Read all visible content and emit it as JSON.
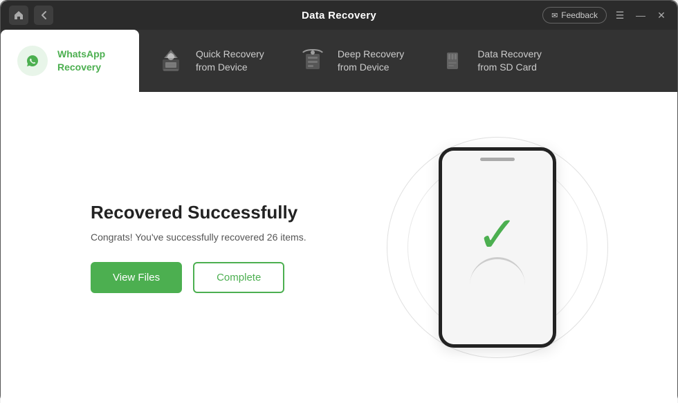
{
  "titleBar": {
    "title": "Data Recovery",
    "feedbackLabel": "Feedback",
    "homeIcon": "home-icon",
    "backIcon": "back-icon",
    "menuIcon": "menu-icon",
    "minimizeIcon": "minimize-icon",
    "closeIcon": "close-icon"
  },
  "navTabs": [
    {
      "id": "whatsapp",
      "label": "WhatsApp\nRecovery",
      "active": true
    },
    {
      "id": "quick-recovery",
      "label": "Quick Recovery\nfrom Device",
      "active": false
    },
    {
      "id": "deep-recovery",
      "label": "Deep Recovery\nfrom Device",
      "active": false
    },
    {
      "id": "sd-card",
      "label": "Data Recovery\nfrom SD Card",
      "active": false
    }
  ],
  "mainContent": {
    "title": "Recovered Successfully",
    "subtitle": "Congrats! You've successfully recovered 26 items.",
    "viewFilesLabel": "View Files",
    "completeLabel": "Complete"
  }
}
